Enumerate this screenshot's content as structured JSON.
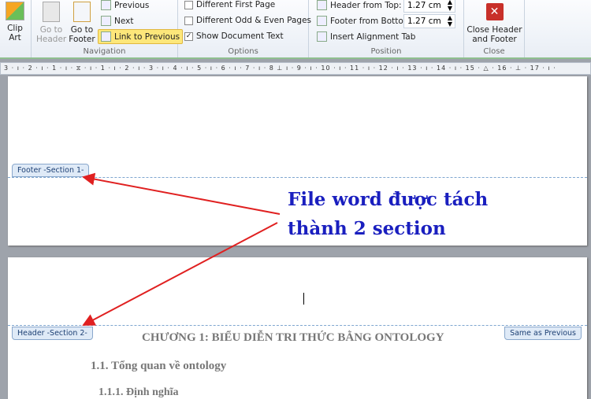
{
  "ribbon": {
    "clip_art": "Clip Art",
    "navigation": {
      "go_to_header": "Go to Header",
      "go_to_footer": "Go to Footer",
      "previous": "Previous",
      "next": "Next",
      "link_to_previous": "Link to Previous",
      "label": "Navigation"
    },
    "options": {
      "different_first_page": "Different First Page",
      "different_odd_even": "Different Odd & Even Pages",
      "show_document_text": "Show Document Text",
      "label": "Options"
    },
    "position": {
      "header_from_top": "Header from Top:",
      "header_value": "1.27 cm",
      "footer_from_bottom": "Footer from Bottom:",
      "footer_value": "1.27 cm",
      "insert_alignment_tab": "Insert Alignment Tab",
      "label": "Position"
    },
    "close": {
      "button": "Close Header and Footer",
      "label": "Close"
    }
  },
  "ruler": "3 · ı · 2 · ı · 1 · ı · ⧖ · ı · 1 · ı · 2 · ı · 3 · ı · 4 · ı · 5 · ı · 6 · ı · 7 · ı · 8 ⊥ ı · 9 · ı · 10 · ı · 11 · ı · 12 · ı · 13 · ı · 14 · ı · 15 · △ · 16 · ⊥ · 17 · ı ·",
  "page1": {
    "footer_tag": "Footer -Section 1-"
  },
  "annotation": {
    "line1": "File word được tách",
    "line2": "thành 2 section"
  },
  "page2": {
    "header_tag": "Header -Section 2-",
    "same_as_previous": "Same as Previous",
    "chapter": "CHƯƠNG 1:  BIỂU DIỄN TRI THỨC BẰNG ONTOLOGY",
    "section": "1.1.  Tổng quan về ontology",
    "subsection": "1.1.1.  Định nghĩa"
  }
}
